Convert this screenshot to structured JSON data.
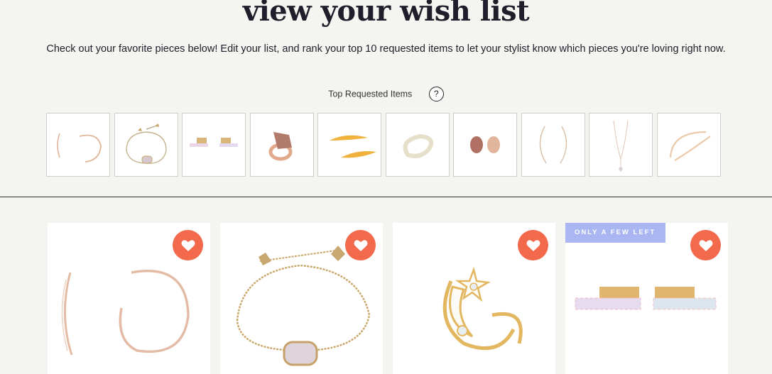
{
  "header": {
    "title": "view your wish list",
    "subtitle": "Check out your favorite pieces below! Edit your list, and rank your top 10 requested items to let your stylist know which pieces you're loving right now."
  },
  "top_requested": {
    "label": "Top Requested Items",
    "help": "?",
    "items": [
      {
        "icon": "hoop-earrings-icon"
      },
      {
        "icon": "bracelet-icon"
      },
      {
        "icon": "bar-earrings-icon"
      },
      {
        "icon": "ring-icon"
      },
      {
        "icon": "ear-climber-icon"
      },
      {
        "icon": "cuff-ring-icon"
      },
      {
        "icon": "stud-earrings-icon"
      },
      {
        "icon": "threader-earrings-icon"
      },
      {
        "icon": "necklace-icon"
      },
      {
        "icon": "cuff-bracelet-icon"
      }
    ]
  },
  "wishlist": {
    "items": [
      {
        "name": "hoop-earrings",
        "badge": ""
      },
      {
        "name": "chain-bracelet",
        "badge": ""
      },
      {
        "name": "moon-star-ring",
        "badge": ""
      },
      {
        "name": "bar-earrings",
        "badge": "ONLY A FEW LEFT"
      }
    ]
  },
  "colors": {
    "background": "#f4f4f0",
    "heart": "#f26a4b",
    "badge": "#a9b6f2",
    "gold": "#d9b57a",
    "rose_gold": "#e2b69b"
  }
}
